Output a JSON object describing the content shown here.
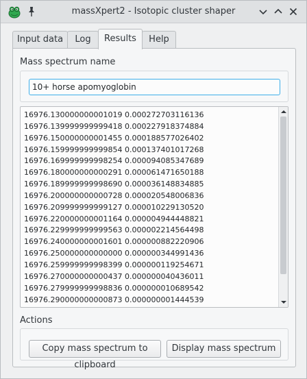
{
  "window": {
    "title": "massXpert2 - Isotopic cluster shaper"
  },
  "tabs": [
    {
      "label": "Input data"
    },
    {
      "label": "Log"
    },
    {
      "label": "Results"
    },
    {
      "label": "Help"
    }
  ],
  "active_tab": "Results",
  "spectrum_name": {
    "label": "Mass spectrum name",
    "value": "10+ horse apomyoglobin"
  },
  "results": {
    "lines": [
      "16976.130000000001019 0.000272703116136",
      "16976.139999999999418 0.000227918374884",
      "16976.150000000001455 0.000188577026402",
      "16976.159999999999854 0.000137401017268",
      "16976.169999999998254 0.000094085347689",
      "16976.180000000000291 0.000061471650188",
      "16976.189999999998690 0.000036148834885",
      "16976.200000000000728 0.000020548006836",
      "16976.209999999999127 0.000010229130520",
      "16976.220000000001164 0.000004944448821",
      "16976.229999999999563 0.000002214564498",
      "16976.240000000001601 0.000000882220906",
      "16976.250000000000000 0.000000344991436",
      "16976.259999999998399 0.000000119254671",
      "16976.270000000000437 0.000000040436011",
      "16976.279999999998836 0.000000010689542",
      "16976.290000000000873 0.000000001444539"
    ],
    "scroll_position": 0.95
  },
  "actions": {
    "label": "Actions",
    "copy_button": "Copy mass spectrum to clipboard",
    "display_button": "Display mass spectrum"
  },
  "colors": {
    "focus_accent": "#3daee9",
    "titlebar": "#dfe1e3",
    "app_icon": "#2fa84f"
  },
  "icons": {
    "app": "frog-app-icon",
    "pin": "pin-icon",
    "window_controls": [
      "chevron-down-icon",
      "chevron-up-icon",
      "close-icon"
    ],
    "scroll": [
      "scroll-up-arrow-icon",
      "scroll-down-arrow-icon"
    ]
  }
}
